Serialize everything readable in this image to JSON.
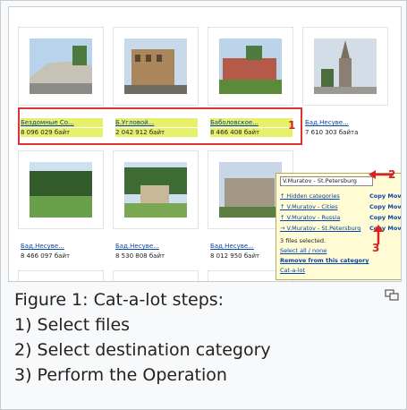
{
  "screenshot": {
    "row1": [
      {
        "title": "",
        "size": ""
      },
      {
        "title": "",
        "size": ""
      },
      {
        "title": "",
        "size": ""
      },
      {
        "title": "",
        "size": ""
      }
    ],
    "row2": [
      {
        "title": "Бездомные Со...",
        "size": "8 096 029 байт"
      },
      {
        "title": "Б.Угловой...",
        "size": "2 042 912 байт"
      },
      {
        "title": "Баболовское...",
        "size": "8 466 408 байт"
      },
      {
        "title": "Бад.Несуве...",
        "size": "7 610 303 байта"
      }
    ],
    "row3": [
      {
        "title": "Бад.Несуве...",
        "size": "8 466 097 байт"
      },
      {
        "title": "Бад.Несуве...",
        "size": "8 530 808 байт"
      },
      {
        "title": "Бад.Несуве...",
        "size": "8 012 950 байт"
      },
      {
        "title": "",
        "size": ""
      }
    ],
    "menu": {
      "input_value": "V.Muratov - St.Petersburg",
      "rows": [
        {
          "category": "↑ Hidden categories",
          "action": "Copy Move"
        },
        {
          "category": "↑ V.Muratov - Cities",
          "action": "Copy Move"
        },
        {
          "category": "↑ V.Muratov - Russia",
          "action": "Copy Move"
        },
        {
          "category": "→ V.Muratov - St.Petersburg",
          "action": "Copy Move"
        }
      ],
      "files_selected": "3 files selected.",
      "select_all_none": "Select all / none",
      "remove_link": "Remove from this category",
      "cat_a_lot": "Cat-a-lot"
    },
    "markers": {
      "one": "1",
      "two": "2",
      "three": "3"
    }
  },
  "caption": {
    "line1": "Figure 1: Cat-a-lot steps:",
    "line2": "1) Select files",
    "line3": "2) Select destination category",
    "line4": "3) Perform the Operation"
  },
  "icons": {
    "enlarge": "magnify-icon"
  }
}
